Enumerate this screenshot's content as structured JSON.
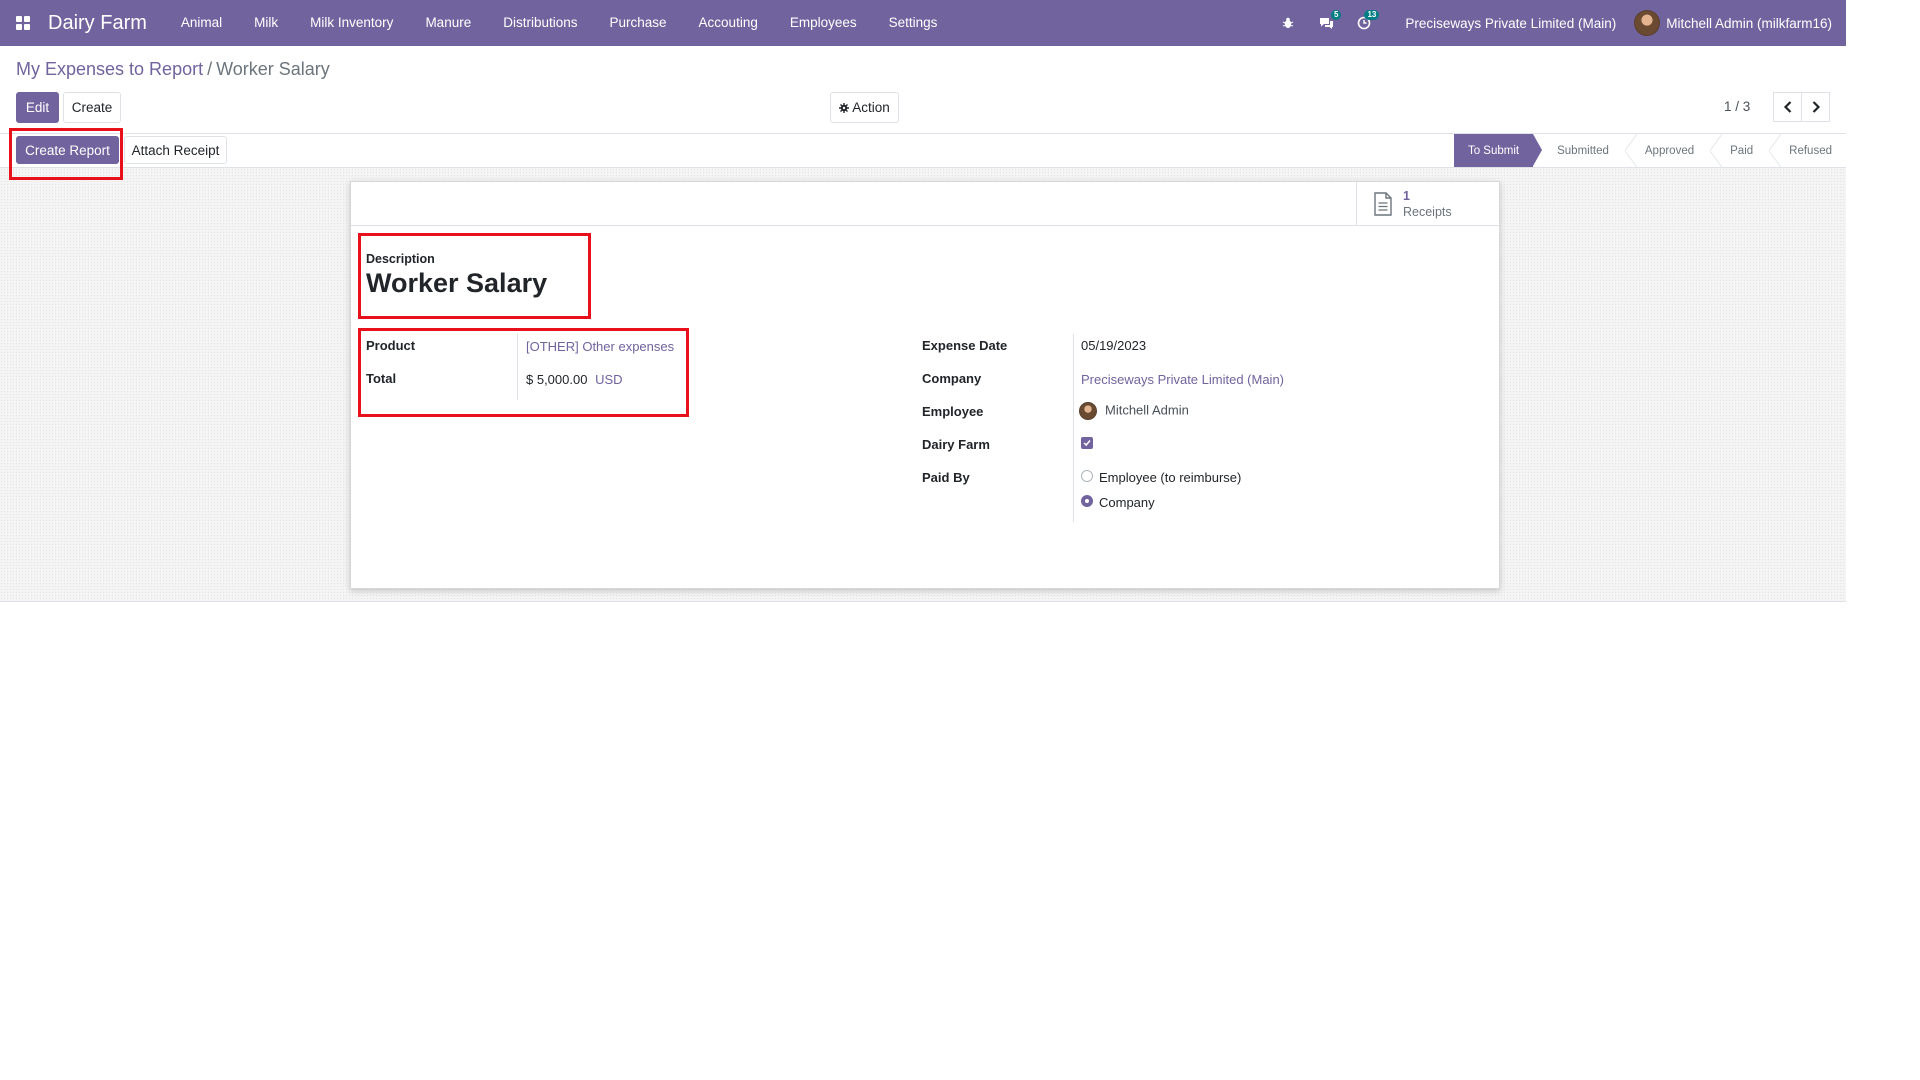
{
  "navbar": {
    "brand": "Dairy Farm",
    "menu": [
      "Animal",
      "Milk",
      "Milk Inventory",
      "Manure",
      "Distributions",
      "Purchase",
      "Accouting",
      "Employees",
      "Settings"
    ],
    "messages_count": "5",
    "activities_count": "13",
    "company": "Preciseways Private Limited (Main)",
    "user": "Mitchell Admin (milkfarm16)"
  },
  "breadcrumb": {
    "parent": "My Expenses to Report",
    "separator": "/",
    "current": "Worker Salary"
  },
  "controls": {
    "edit": "Edit",
    "create": "Create",
    "action": "Action",
    "pager": "1 / 3"
  },
  "header_buttons": {
    "create_report": "Create Report",
    "attach_receipt": "Attach Receipt"
  },
  "status_steps": [
    "To Submit",
    "Submitted",
    "Approved",
    "Paid",
    "Refused"
  ],
  "active_step": "To Submit",
  "smart_button": {
    "value": "1",
    "label": "Receipts"
  },
  "form": {
    "description_label": "Description",
    "description": "Worker Salary",
    "product_label": "Product",
    "product": "[OTHER] Other expenses",
    "total_label": "Total",
    "total": "$ 5,000.00",
    "currency": "USD",
    "expense_date_label": "Expense Date",
    "expense_date": "05/19/2023",
    "company_label": "Company",
    "company": "Preciseways Private Limited (Main)",
    "employee_label": "Employee",
    "employee": "Mitchell Admin",
    "dairy_farm_label": "Dairy Farm",
    "dairy_farm_checked": true,
    "paid_by_label": "Paid By",
    "paid_by_options": [
      "Employee (to reimburse)",
      "Company"
    ],
    "paid_by_selected": "Company"
  },
  "colors": {
    "brand": "#71639e",
    "highlight": "#e8101a"
  },
  "icons": [
    "apps-grid-icon",
    "bug-icon",
    "chat-icon",
    "clock-icon",
    "gear-icon",
    "chevron-left-icon",
    "chevron-right-icon",
    "document-icon",
    "check-icon"
  ]
}
